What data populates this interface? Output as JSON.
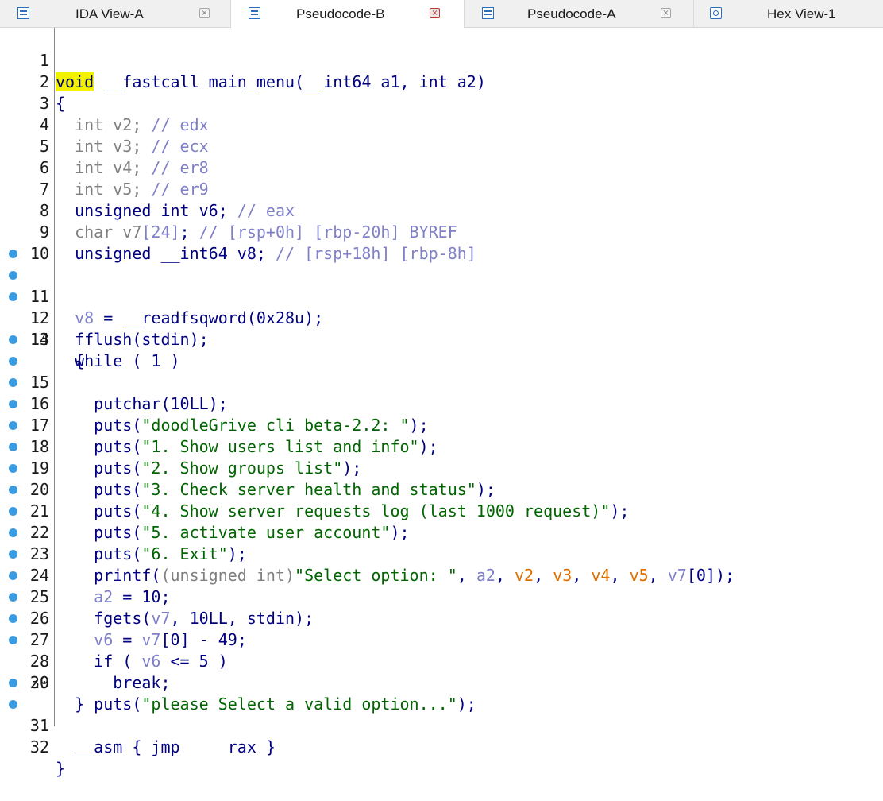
{
  "tabs": [
    {
      "label": "IDA View-A",
      "icon": "text-view-icon",
      "active": false
    },
    {
      "label": "Pseudocode-B",
      "icon": "text-view-icon",
      "active": true
    },
    {
      "label": "Pseudocode-A",
      "icon": "text-view-icon",
      "active": false
    },
    {
      "label": "Hex View-1",
      "icon": "hex-view-icon",
      "active": false
    }
  ],
  "code": {
    "line_numbers": [
      "1",
      "2",
      "3",
      "4",
      "5",
      "6",
      "7",
      "8",
      "9",
      "10",
      "11",
      "12",
      "13",
      "14",
      "15",
      "16",
      "17",
      "18",
      "19",
      "20",
      "21",
      "22",
      "23",
      "24",
      "25",
      "26",
      "27",
      "28",
      "29",
      "30",
      "31",
      "32"
    ],
    "breakpoint_lines": [
      11,
      12,
      13,
      15,
      16,
      17,
      18,
      19,
      20,
      21,
      22,
      23,
      24,
      25,
      26,
      27,
      28,
      29,
      31,
      32
    ],
    "highlighted_token": "void",
    "tokens": {
      "l1_ret": "void",
      "l1_sig": " __fastcall main_menu(__int64 a1, int a2)",
      "l2": "{",
      "l3_decl": "  int v2; ",
      "l3_cmt": "// edx",
      "l4_decl": "  int v3; ",
      "l4_cmt": "// ecx",
      "l5_decl": "  int v4; ",
      "l5_cmt": "// er8",
      "l6_decl": "  int v5; ",
      "l6_cmt": "// er9",
      "l7_decl": "  unsigned int v6; ",
      "l7_cmt": "// eax",
      "l8_a": "  char v7",
      "l8_b": "[24]",
      "l8_c": "; ",
      "l8_cmt": "// [rsp+0h] [rbp-20h] BYREF",
      "l9_decl": "  unsigned __int64 v8; ",
      "l9_cmt": "// [rsp+18h] [rbp-8h]",
      "l10": "",
      "l11_a": "  v8",
      "l11_b": " = __readfsqword(0x28u);",
      "l12": "  fflush(stdin);",
      "l13": "  while ( 1 )",
      "l14": "  {",
      "l15": "    putchar(10LL);",
      "l16_a": "    puts(",
      "l16_s": "\"doodleGrive cli beta-2.2: \"",
      "l16_b": ");",
      "l17_a": "    puts(",
      "l17_s": "\"1. Show users list and info\"",
      "l17_b": ");",
      "l18_a": "    puts(",
      "l18_s": "\"2. Show groups list\"",
      "l18_b": ");",
      "l19_a": "    puts(",
      "l19_s": "\"3. Check server health and status\"",
      "l19_b": ");",
      "l20_a": "    puts(",
      "l20_s": "\"4. Show server requests log (last 1000 request)\"",
      "l20_b": ");",
      "l21_a": "    puts(",
      "l21_s": "\"5. activate user account\"",
      "l21_b": ");",
      "l22_a": "    puts(",
      "l22_s": "\"6. Exit\"",
      "l22_b": ");",
      "l23_a": "    printf(",
      "l23_cast": "(unsigned int)",
      "l23_s": "\"Select option: \"",
      "l23_c1": ", ",
      "l23_a2": "a2",
      "l23_c2": ", ",
      "l23_v2": "v2",
      "l23_c3": ", ",
      "l23_v3": "v3",
      "l23_c4": ", ",
      "l23_v4": "v4",
      "l23_c5": ", ",
      "l23_v5": "v5",
      "l23_c6": ", ",
      "l23_v7": "v7",
      "l23_e": "[0]);",
      "l24_a": "    ",
      "l24_v": "a2",
      "l24_b": " = 10;",
      "l25_a": "    fgets(",
      "l25_v": "v7",
      "l25_b": ", 10LL, stdin);",
      "l26_a": "    ",
      "l26_v6": "v6",
      "l26_b": " = ",
      "l26_v7": "v7",
      "l26_c": "[0] - 49;",
      "l27_a": "    if ( ",
      "l27_v": "v6",
      "l27_b": " <= 5 )",
      "l28": "      break;",
      "l29_a": "    puts(",
      "l29_s": "\"please Select a valid option...\"",
      "l29_b": ");",
      "l30": "  }",
      "l31": "  __asm { jmp     rax }",
      "l32": "}"
    }
  },
  "colors": {
    "keyword": "#000080",
    "string": "#006400",
    "comment": "#8080c8",
    "var_light": "#8080c8",
    "var_orange": "#e07000",
    "breakpoint": "#3a9be0",
    "highlight": "#f2f200"
  }
}
